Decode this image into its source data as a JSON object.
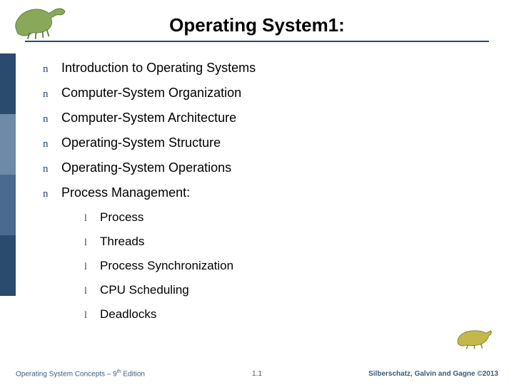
{
  "title": "Operating System1:",
  "bullets": [
    "Introduction to Operating Systems",
    "Computer-System Organization",
    "Computer-System Architecture",
    "Operating-System Structure",
    "Operating-System Operations",
    "Process Management:"
  ],
  "subbullets": [
    "Process",
    "Threads",
    "Process Synchronization",
    "CPU Scheduling",
    "Deadlocks"
  ],
  "footer": {
    "left_prefix": "Operating System Concepts – 9",
    "left_sup": "th",
    "left_suffix": " Edition",
    "center": "1.1",
    "right": "Silberschatz, Galvin and Gagne ©2013"
  },
  "glyph": {
    "n": "n",
    "l": "l"
  }
}
